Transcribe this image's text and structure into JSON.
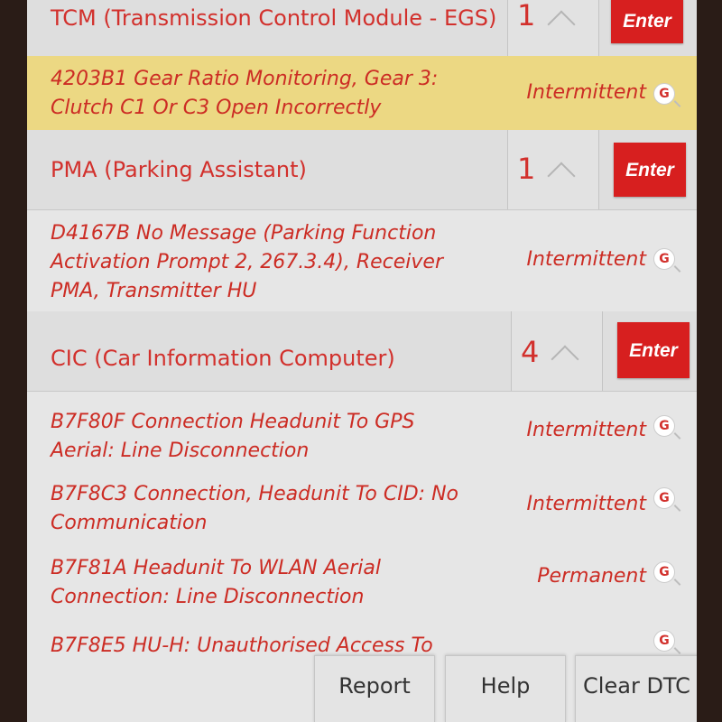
{
  "modules": [
    {
      "name": "TCM (Transmission Control Module - EGS)",
      "count": "1",
      "enter_label": "Enter"
    },
    {
      "name": "PMA (Parking Assistant)",
      "count": "1",
      "enter_label": "Enter"
    },
    {
      "name": "CIC (Car Information Computer)",
      "count": "4",
      "enter_label": "Enter"
    }
  ],
  "faults": [
    {
      "text": "4203B1 Gear Ratio Monitoring, Gear 3: Clutch C1 Or C3 Open Incorrectly",
      "status": "Intermittent",
      "search_glyph": "G"
    },
    {
      "text": "D4167B No Message (Parking Function Activation Prompt 2, 267.3.4), Receiver PMA, Transmitter HU",
      "status": "Intermittent",
      "search_glyph": "G"
    },
    {
      "text": "B7F80F Connection Headunit To GPS Aerial: Line Disconnection",
      "status": "Intermittent",
      "search_glyph": "G"
    },
    {
      "text": "B7F8C3 Connection, Headunit To CID: No Communication",
      "status": "Intermittent",
      "search_glyph": "G"
    },
    {
      "text": "B7F81A Headunit To WLAN Aerial Connection: Line Disconnection",
      "status": "Permanent",
      "search_glyph": "G"
    },
    {
      "text": "B7F8E5 HU-H: Unauthorised Access To",
      "status": "",
      "search_glyph": "G"
    }
  ],
  "footer": {
    "report_label": "Report",
    "help_label": "Help",
    "clear_label": "Clear DTC"
  },
  "colors": {
    "accent": "#d71f1f",
    "text_red": "#cc2c24",
    "highlight_row": "#ecd883"
  },
  "icons": {
    "search": "google-search-icon",
    "expand": "chevron-up-icon"
  }
}
